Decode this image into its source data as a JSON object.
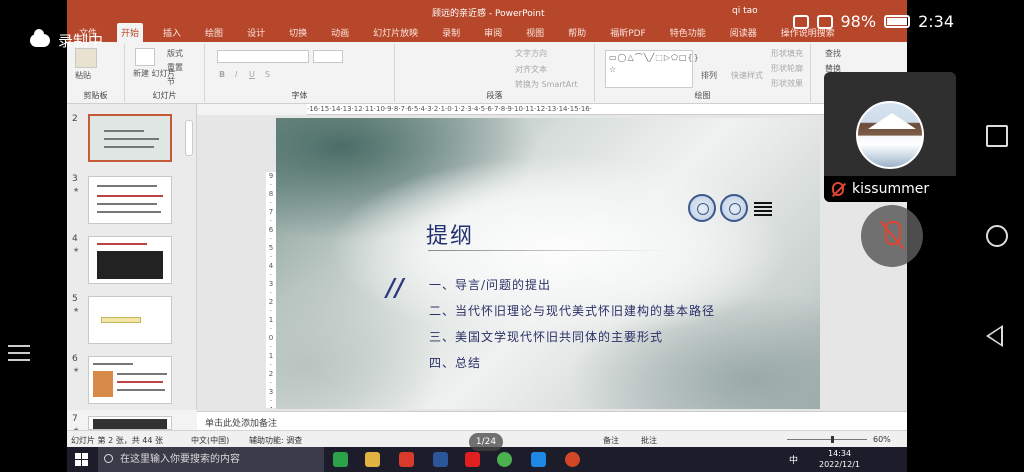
{
  "android": {
    "recording_label": "录制中",
    "battery": "98%",
    "time": "2:34"
  },
  "ppt": {
    "window_title": "顾远的亲近感 - PowerPoint",
    "user": "qi tao",
    "tabs": [
      "文件",
      "开始",
      "插入",
      "绘图",
      "设计",
      "切换",
      "动画",
      "幻灯片放映",
      "录制",
      "审阅",
      "视图",
      "帮助",
      "福昕PDF",
      "特色功能",
      "阅读器",
      "操作说明搜索"
    ],
    "active_tab": "开始",
    "ribbon": {
      "paste": "粘贴",
      "new_slide": "新建\n幻灯片",
      "layout": "版式",
      "reset": "重置",
      "section": "节",
      "groups": [
        "剪贴板",
        "幻灯片",
        "字体",
        "段落",
        "绘图"
      ],
      "text_direction": "文字方向",
      "align_text": "对齐文本",
      "smartart": "转换为 SmartArt",
      "arrange": "排列",
      "quick_styles": "快速样式",
      "shape_fill": "形状填充",
      "shape_outline": "形状轮廓",
      "shape_effects": "形状效果",
      "find": "查找",
      "replace": "替换",
      "select": "选择"
    },
    "ruler_h": "·16·15·14·13·12·11·10·9·8·7·6·5·4·3·2·1·0·1·2·3·4·5·6·7·8·9·10·11·12·13·14·15·16·",
    "ruler_v": "9·8·7·6·5·4·3·2·1·0·1·2·3·4·5·6",
    "thumbnails": [
      {
        "num": "2",
        "star": "",
        "selected": true
      },
      {
        "num": "3",
        "star": "★",
        "selected": false
      },
      {
        "num": "4",
        "star": "★",
        "selected": false
      },
      {
        "num": "5",
        "star": "★",
        "selected": false
      },
      {
        "num": "6",
        "star": "★",
        "selected": false
      },
      {
        "num": "7",
        "star": "★",
        "selected": false
      }
    ],
    "slide": {
      "title": "提纲",
      "items": [
        "一、导言/问题的提出",
        "二、当代怀旧理论与现代美式怀旧建构的基本路径",
        "三、美国文学现代怀旧共同体的主要形式",
        "四、总结"
      ]
    },
    "notes_placeholder": "单击此处添加备注",
    "status": {
      "slide_info": "幻灯片 第 2 张，共 44 张",
      "language": "中文(中国)",
      "accessibility": "辅助功能: 调查",
      "notes_btn": "备注",
      "comments_btn": "批注",
      "zoom": "60%"
    },
    "page_indicator": "1/24"
  },
  "taskbar": {
    "search_placeholder": "在这里输入你要搜索的内容",
    "ime": "中",
    "clock_time": "14:34",
    "clock_date": "2022/12/1"
  },
  "call": {
    "participant": "kissummer"
  }
}
